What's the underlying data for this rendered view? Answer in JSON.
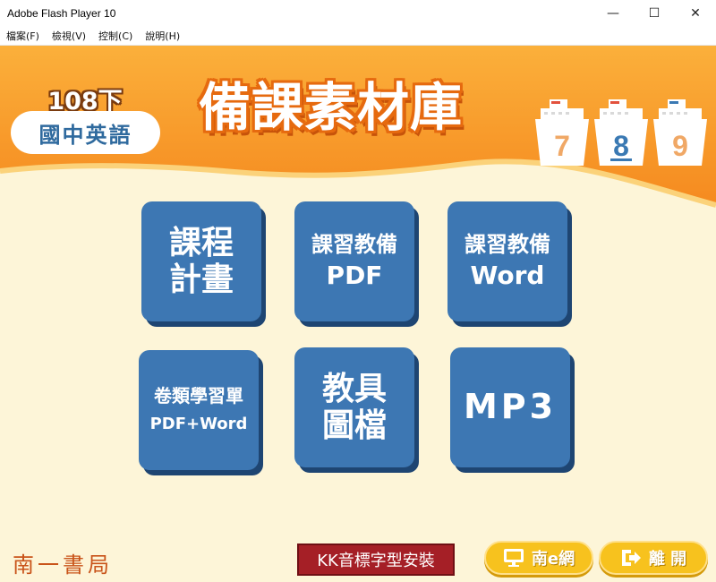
{
  "window": {
    "title": "Adobe Flash Player 10",
    "controls": {
      "minimize": "—",
      "maximize": "☐",
      "close": "✕"
    }
  },
  "menu": [
    {
      "label": "檔案(F)"
    },
    {
      "label": "檢視(V)"
    },
    {
      "label": "控制(C)"
    },
    {
      "label": "說明(H)"
    }
  ],
  "header": {
    "grade_label": "108下",
    "subject": "國中英語",
    "title": "備課素材庫",
    "grades": [
      "7",
      "8",
      "9"
    ]
  },
  "tiles": [
    {
      "lines": [
        "課程",
        "計畫"
      ]
    },
    {
      "lines": [
        "課習教備",
        "PDF"
      ]
    },
    {
      "lines": [
        "課習教備",
        "Word"
      ]
    },
    {
      "lines": [
        "卷類學習單",
        "PDF+Word"
      ]
    },
    {
      "lines": [
        "教具",
        "圖檔"
      ]
    },
    {
      "lines": [
        "MP3"
      ]
    }
  ],
  "footer": {
    "publisher": "南一書局",
    "kk_font_install": "KK音標字型安裝",
    "nanyi_net": "南e網",
    "exit": "離 開"
  },
  "colors": {
    "header_orange": "#f79a2a",
    "tile_blue": "#3d77b3",
    "background": "#fdf5d8",
    "button_yellow": "#f7c21e",
    "kk_red": "#a51f26",
    "grade7": "#f0a866",
    "grade8": "#3a79b3",
    "grade9": "#f0a866"
  },
  "icons": {
    "net_button": "monitor-icon",
    "exit_button": "exit-arrow-icon"
  }
}
